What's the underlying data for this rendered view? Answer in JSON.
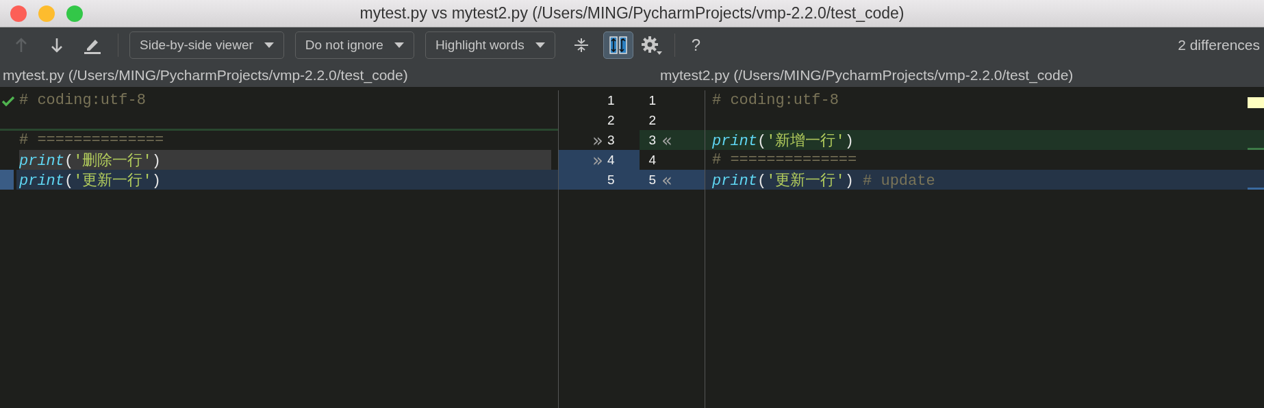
{
  "window": {
    "title": "mytest.py vs mytest2.py (/Users/MING/PycharmProjects/vmp-2.2.0/test_code)"
  },
  "toolbar": {
    "nav_buttons": [
      {
        "kind": "up",
        "disabled": true
      },
      {
        "kind": "down",
        "disabled": false
      },
      {
        "kind": "edit",
        "disabled": false
      }
    ],
    "dropdowns": [
      {
        "label": "Side-by-side viewer"
      },
      {
        "label": "Do not ignore"
      },
      {
        "label": "Highlight words"
      }
    ],
    "toggles": [
      {
        "kind": "collapse",
        "selected": false
      },
      {
        "kind": "sync",
        "selected": true
      }
    ],
    "help": "?",
    "status": "2 differences"
  },
  "left_pane": {
    "header": "mytest.py (/Users/MING/PycharmProjects/vmp-2.2.0/test_code)",
    "lines": [
      {
        "kind": "plain",
        "tokens": [
          {
            "kind": "comment",
            "text": "# coding:utf-8"
          }
        ]
      },
      {
        "kind": "plain"
      },
      {
        "kind": "plain",
        "insertion_above": true,
        "tokens": [
          {
            "kind": "comment",
            "text": "# =============="
          }
        ]
      },
      {
        "kind": "deleted",
        "tokens": [
          {
            "kind": "keyword",
            "text": "print"
          },
          {
            "kind": "punct",
            "text": "("
          },
          {
            "kind": "string",
            "text": "'删除一行'"
          },
          {
            "kind": "punct",
            "text": ")"
          }
        ]
      },
      {
        "kind": "modified",
        "tokens": [
          {
            "kind": "keyword",
            "text": "print"
          },
          {
            "kind": "punct",
            "text": "("
          },
          {
            "kind": "string",
            "text": "'更新一行'"
          },
          {
            "kind": "punct",
            "text": ")"
          }
        ]
      }
    ]
  },
  "gutter": [
    {
      "kind": "plain",
      "left_number": "1",
      "right_number": "1"
    },
    {
      "kind": "plain",
      "left_number": "2",
      "right_number": "2"
    },
    {
      "kind": "inserted",
      "left_marker": "»",
      "left_number": "3",
      "right_number": "3",
      "right_marker": "«"
    },
    {
      "kind": "deleted",
      "left_marker": "»",
      "left_number": "4",
      "right_number": "4"
    },
    {
      "kind": "modified",
      "left_number": "5",
      "right_number": "5",
      "right_marker": "«"
    }
  ],
  "right_pane": {
    "header": "mytest2.py (/Users/MING/PycharmProjects/vmp-2.2.0/test_code)",
    "lines": [
      {
        "kind": "plain",
        "tokens": [
          {
            "kind": "comment",
            "text": "# coding:utf-8"
          }
        ]
      },
      {
        "kind": "plain"
      },
      {
        "kind": "inserted",
        "tokens": [
          {
            "kind": "keyword",
            "text": "print"
          },
          {
            "kind": "punct",
            "text": "("
          },
          {
            "kind": "string",
            "text": "'新增一行'"
          },
          {
            "kind": "punct",
            "text": ")"
          }
        ]
      },
      {
        "kind": "plain",
        "tokens": [
          {
            "kind": "comment",
            "text": "# =============="
          }
        ]
      },
      {
        "kind": "modified",
        "tokens": [
          {
            "kind": "keyword",
            "text": "print"
          },
          {
            "kind": "punct",
            "text": "("
          },
          {
            "kind": "string",
            "text": "'更新一行'"
          },
          {
            "kind": "punct",
            "text": ")"
          },
          {
            "kind": "comment",
            "text": " # update"
          }
        ]
      }
    ]
  }
}
